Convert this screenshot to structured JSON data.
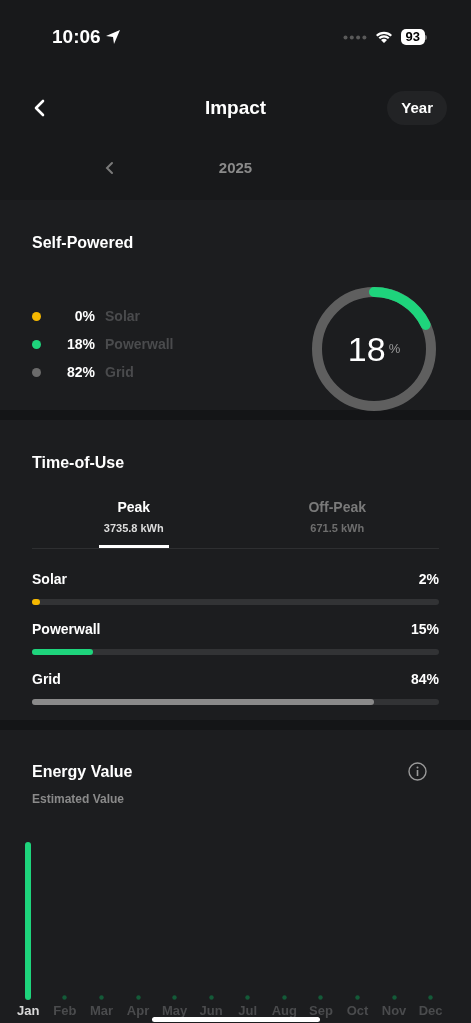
{
  "status_bar": {
    "time": "10:06",
    "battery": "93"
  },
  "header": {
    "title": "Impact",
    "period_button": "Year",
    "year": "2025"
  },
  "self_powered": {
    "title": "Self-Powered",
    "donut": {
      "value": "18",
      "unit": "%",
      "level": 0.18
    },
    "legend": [
      {
        "percent": "0%",
        "label": "Solar",
        "color": "#f5b800"
      },
      {
        "percent": "18%",
        "label": "Powerwall",
        "color": "#1ed47c"
      },
      {
        "percent": "82%",
        "label": "Grid",
        "color": "#6b6b6b"
      }
    ]
  },
  "time_of_use": {
    "title": "Time-of-Use",
    "tabs": [
      {
        "label": "Peak",
        "value": "3735.8 kWh",
        "selected": true
      },
      {
        "label": "Off-Peak",
        "value": "671.5 kWh",
        "selected": false
      }
    ],
    "bars": [
      {
        "label": "Solar",
        "reading": "2%",
        "level": 0.02,
        "color": "#f5b800"
      },
      {
        "label": "Powerwall",
        "reading": "15%",
        "level": 0.15,
        "color": "#1ed47c"
      },
      {
        "label": "Grid",
        "reading": "84%",
        "level": 0.84,
        "color": "#8a8a8a"
      }
    ]
  },
  "energy_value": {
    "title": "Energy Value",
    "subtitle": "Estimated Value",
    "months": [
      {
        "label": "Jan",
        "kind": "bar",
        "selected": true
      },
      {
        "label": "Feb",
        "kind": "dot",
        "selected": false
      },
      {
        "label": "Mar",
        "kind": "dot",
        "selected": false
      },
      {
        "label": "Apr",
        "kind": "dot",
        "selected": false
      },
      {
        "label": "May",
        "kind": "dot",
        "selected": false
      },
      {
        "label": "Jun",
        "kind": "dot",
        "selected": false
      },
      {
        "label": "Jul",
        "kind": "dot",
        "selected": false
      },
      {
        "label": "Aug",
        "kind": "dot",
        "selected": false
      },
      {
        "label": "Sep",
        "kind": "dot",
        "selected": false
      },
      {
        "label": "Oct",
        "kind": "dot",
        "selected": false
      },
      {
        "label": "Nov",
        "kind": "dot",
        "selected": false
      },
      {
        "label": "Dec",
        "kind": "dot",
        "selected": false
      }
    ]
  }
}
